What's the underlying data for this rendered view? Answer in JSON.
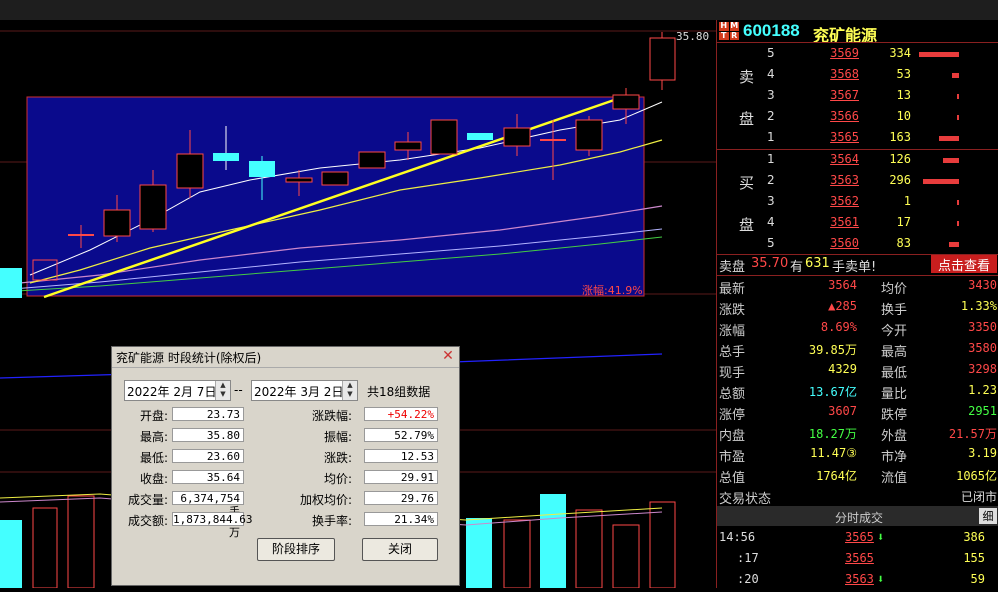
{
  "header": {
    "hmtr": [
      "H",
      "M",
      "T",
      "R"
    ],
    "code": "600188",
    "name": "兖矿能源"
  },
  "chart": {
    "price_label": "35.80",
    "range_label": "涨幅:41.9%"
  },
  "orderbook": {
    "sell_label_1": "卖",
    "sell_label_2": "盘",
    "buy_label_1": "买",
    "buy_label_2": "盘",
    "sells": [
      {
        "level": "5",
        "price": "3569",
        "vol": "334",
        "bar": 0.95
      },
      {
        "level": "4",
        "price": "3568",
        "vol": "53",
        "bar": 0.16
      },
      {
        "level": "3",
        "price": "3567",
        "vol": "13",
        "bar": 0.04
      },
      {
        "level": "2",
        "price": "3566",
        "vol": "10",
        "bar": 0.03
      },
      {
        "level": "1",
        "price": "3565",
        "vol": "163",
        "bar": 0.47
      }
    ],
    "buys": [
      {
        "level": "1",
        "price": "3564",
        "vol": "126",
        "bar": 0.37
      },
      {
        "level": "2",
        "price": "3563",
        "vol": "296",
        "bar": 0.86
      },
      {
        "level": "3",
        "price": "3562",
        "vol": "1",
        "bar": 0.0
      },
      {
        "level": "4",
        "price": "3561",
        "vol": "17",
        "bar": 0.05
      },
      {
        "level": "5",
        "price": "3560",
        "vol": "83",
        "bar": 0.24
      }
    ]
  },
  "note": {
    "prefix": "卖盘",
    "price": "35.70",
    "mid": "有",
    "qty": "631",
    "suffix": "手卖单!",
    "button": "点击查看"
  },
  "stats": [
    {
      "l1": "最新",
      "v1": "3564",
      "c1": "#ff4848",
      "l2": "均价",
      "v2": "3430",
      "c2": "#ff4848"
    },
    {
      "l1": "涨跌",
      "v1": "▲285",
      "c1": "#ff4848",
      "l2": "换手",
      "v2": "1.33%",
      "c2": "#ffff55"
    },
    {
      "l1": "涨幅",
      "v1": "8.69%",
      "c1": "#ff4848",
      "l2": "今开",
      "v2": "3350",
      "c2": "#ff4848"
    },
    {
      "l1": "总手",
      "v1": "39.85万",
      "c1": "#ffff55",
      "l2": "最高",
      "v2": "3580",
      "c2": "#ff4848"
    },
    {
      "l1": "现手",
      "v1": "4329",
      "c1": "#ffff55",
      "l2": "最低",
      "v2": "3298",
      "c2": "#ff4848"
    },
    {
      "l1": "总额",
      "v1": "13.67亿",
      "c1": "#4ff",
      "l2": "量比",
      "v2": "1.23",
      "c2": "#ffff55"
    },
    {
      "l1": "涨停",
      "v1": "3607",
      "c1": "#ff4848",
      "l2": "跌停",
      "v2": "2951",
      "c2": "#44ff44"
    },
    {
      "l1": "内盘",
      "v1": "18.27万",
      "c1": "#44ff44",
      "l2": "外盘",
      "v2": "21.57万",
      "c2": "#ff4848"
    },
    {
      "l1": "市盈",
      "v1": "11.47③",
      "c1": "#ffff55",
      "l2": "市净",
      "v2": "3.19",
      "c2": "#ffff55"
    },
    {
      "l1": "总值",
      "v1": "1764亿",
      "c1": "#ffff55",
      "l2": "流值",
      "v2": "1065亿",
      "c2": "#ffff55"
    },
    {
      "l1": "交易状态",
      "v1": "",
      "c1": "#fff",
      "l2": "",
      "v2": "已闭市",
      "c2": "#ddd"
    }
  ],
  "trades": {
    "title": "分时成交",
    "tab": "细",
    "rows": [
      {
        "time": "14:56",
        "price": "3565",
        "arrow": "⬇",
        "vol": "386"
      },
      {
        "time": ":17",
        "price": "3565",
        "arrow": "",
        "vol": "155"
      },
      {
        "time": ":20",
        "price": "3563",
        "arrow": "⬇",
        "vol": "59"
      }
    ]
  },
  "dialog": {
    "title": "兖矿能源 时段统计(除权后)",
    "date_from": "2022年  2月 7日",
    "sep": "--",
    "date_to": "2022年  3月 2日",
    "count": "共18组数据",
    "left": [
      {
        "label": "开盘:",
        "value": "23.73"
      },
      {
        "label": "最高:",
        "value": "35.80"
      },
      {
        "label": "最低:",
        "value": "23.60"
      },
      {
        "label": "收盘:",
        "value": "35.64"
      },
      {
        "label": "成交量:",
        "value": "6,374,754手"
      },
      {
        "label": "成交额:",
        "value": "1,873,844.63万"
      }
    ],
    "right": [
      {
        "label": "涨跌幅:",
        "value": "+54.22%"
      },
      {
        "label": "振幅:",
        "value": "52.79%"
      },
      {
        "label": "涨跌:",
        "value": "12.53"
      },
      {
        "label": "均价:",
        "value": "29.91"
      },
      {
        "label": "加权均价:",
        "value": "29.76"
      },
      {
        "label": "换手率:",
        "value": "21.34%"
      }
    ],
    "btn_sort": "阶段排序",
    "btn_close": "关闭"
  }
}
